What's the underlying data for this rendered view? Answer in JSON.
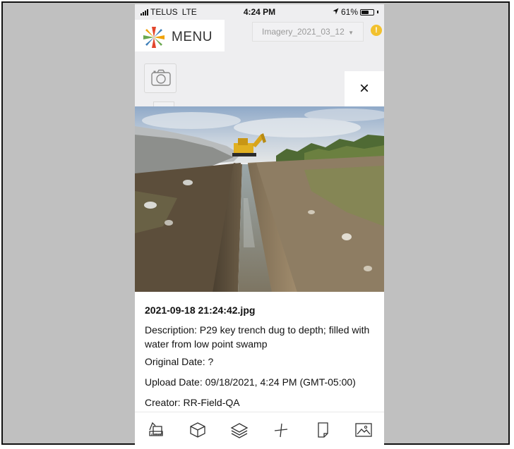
{
  "status_bar": {
    "carrier": "TELUS",
    "network": "LTE",
    "time": "4:24 PM",
    "battery_text": "61%",
    "battery_level": 0.61
  },
  "header": {
    "menu_label": "MENU",
    "imagery_select": "Imagery_2021_03_12",
    "alert_icon": "!"
  },
  "close_label": "×",
  "photo": {
    "filename": "2021-09-18 21:24:42.jpg",
    "description": "Description: P29 key trench dug to depth; filled with water from low point swamp",
    "original_date": "Original Date: ?",
    "upload_date": "Upload Date: 09/18/2021, 4:24 PM (GMT-05:00)",
    "creator": "Creator: RR-Field-QA"
  },
  "toolbar_icons": [
    "measure-icon",
    "cube-icon",
    "layers-icon",
    "compass-icon",
    "document-icon",
    "image-icon"
  ],
  "colors": {
    "alert": "#f2c12e",
    "background": "#eeeef0"
  }
}
